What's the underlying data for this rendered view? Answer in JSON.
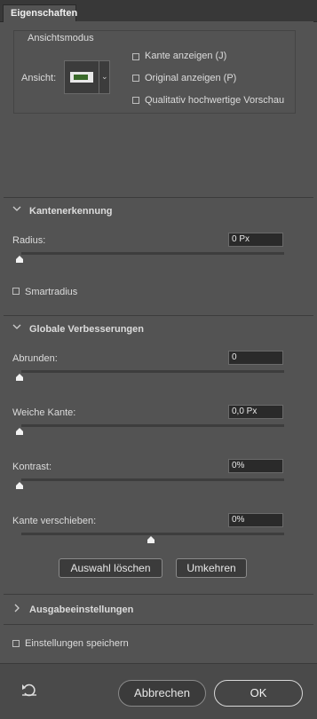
{
  "panel": {
    "tab_title": "Eigenschaften"
  },
  "view_mode": {
    "group_title": "Ansichtsmodus",
    "view_label": "Ansicht:",
    "options": [
      {
        "label": "Kante anzeigen (J)",
        "checked": false
      },
      {
        "label": "Original anzeigen (P)",
        "checked": false
      },
      {
        "label": "Qualitativ hochwertige Vorschau",
        "checked": false
      }
    ]
  },
  "edge_detection": {
    "title": "Kantenerkennung",
    "radius_label": "Radius:",
    "radius_value": "0 Px",
    "radius_level": 0,
    "smart_radius_label": "Smartradius",
    "smart_radius_checked": false
  },
  "global_refinements": {
    "title": "Globale Verbesserungen",
    "sliders": [
      {
        "label": "Abrunden:",
        "value": "0",
        "level": 0
      },
      {
        "label": "Weiche Kante:",
        "value": "0,0 Px",
        "level": 0
      },
      {
        "label": "Kontrast:",
        "value": "0%",
        "level": 0
      },
      {
        "label": "Kante verschieben:",
        "value": "0%",
        "level": 0.5
      }
    ],
    "clear_selection_label": "Auswahl löschen",
    "invert_label": "Umkehren"
  },
  "output": {
    "title": "Ausgabeeinstellungen"
  },
  "save_settings": {
    "label": "Einstellungen speichern",
    "checked": false
  },
  "footer": {
    "cancel_label": "Abbrechen",
    "ok_label": "OK"
  },
  "icons": {
    "reset": "reset-icon",
    "expand": "chevron-down-icon",
    "collapsed": "chevron-right-icon",
    "view_dropdown": "chevron-down-icon"
  }
}
